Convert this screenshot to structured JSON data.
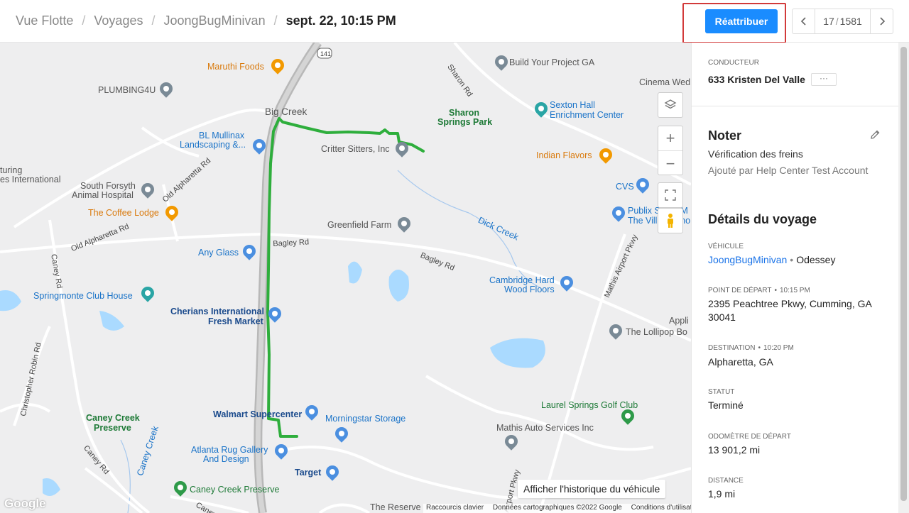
{
  "breadcrumb": {
    "items": [
      "Vue Flotte",
      "Voyages",
      "JoongBugMinivan"
    ],
    "current": "sept. 22, 10:15 PM"
  },
  "toolbar": {
    "reassign_label": "Réattribuer",
    "pager_current": "17",
    "pager_total": "1581",
    "pager_separator": "/"
  },
  "map": {
    "labels": [
      {
        "text": "Maruthi Foods",
        "kind": "orange"
      },
      {
        "text": "Build Your Project GA",
        "kind": "plain"
      },
      {
        "text": "Sharon Rd",
        "kind": "road"
      },
      {
        "text": "PLUMBING4U",
        "kind": "plain"
      },
      {
        "text": "Cinema Wed",
        "kind": "plain"
      },
      {
        "text": "Big Creek",
        "kind": "plain"
      },
      {
        "text": "Sexton Hall",
        "kind": "blue"
      },
      {
        "text": "Enrichment Center",
        "kind": "blue"
      },
      {
        "text": "Sharon",
        "kind": "green"
      },
      {
        "text": "Springs Park",
        "kind": "green"
      },
      {
        "text": "BL Mullinax",
        "kind": "blue"
      },
      {
        "text": "Landscaping &...",
        "kind": "blue"
      },
      {
        "text": "Critter Sitters, Inc",
        "kind": "plain"
      },
      {
        "text": "Indian Flavors",
        "kind": "orange"
      },
      {
        "text": "turing",
        "kind": "plain"
      },
      {
        "text": "es International",
        "kind": "plain"
      },
      {
        "text": "Old Alpharetta Rd",
        "kind": "road"
      },
      {
        "text": "South Forsyth",
        "kind": "plain"
      },
      {
        "text": "Animal Hospital",
        "kind": "plain"
      },
      {
        "text": "CVS",
        "kind": "blue"
      },
      {
        "text": "The Coffee Lodge",
        "kind": "orange"
      },
      {
        "text": "Publix Super M",
        "kind": "blue"
      },
      {
        "text": "The Village Sho",
        "kind": "blue"
      },
      {
        "text": "Old Alpharetta Rd",
        "kind": "road"
      },
      {
        "text": "Greenfield Farm",
        "kind": "plain"
      },
      {
        "text": "Dick Creek",
        "kind": "blue"
      },
      {
        "text": "Any Glass",
        "kind": "blue"
      },
      {
        "text": "Bagley Rd",
        "kind": "road"
      },
      {
        "text": "Bagley Rd",
        "kind": "road"
      },
      {
        "text": "Mathis Airport Pkwy",
        "kind": "road"
      },
      {
        "text": "Caney Rd",
        "kind": "road"
      },
      {
        "text": "Cambridge Hard",
        "kind": "blue"
      },
      {
        "text": "Wood Floors",
        "kind": "blue"
      },
      {
        "text": "Springmonte Club House",
        "kind": "blue"
      },
      {
        "text": "Cherians International",
        "kind": "dark"
      },
      {
        "text": "Fresh Market",
        "kind": "dark"
      },
      {
        "text": "Appli",
        "kind": "plain"
      },
      {
        "text": "The Lollipop Bo",
        "kind": "plain"
      },
      {
        "text": "Christopher Robin Rd",
        "kind": "road"
      },
      {
        "text": "Laurel Springs Golf Club",
        "kind": "green"
      },
      {
        "text": "Walmart Supercenter",
        "kind": "dark"
      },
      {
        "text": "Morningstar Storage",
        "kind": "blue"
      },
      {
        "text": "Caney Creek",
        "kind": "green"
      },
      {
        "text": "Preserve",
        "kind": "green"
      },
      {
        "text": "Mathis Auto Services Inc",
        "kind": "plain"
      },
      {
        "text": "Atlanta Rug Gallery",
        "kind": "blue"
      },
      {
        "text": "And Design",
        "kind": "blue"
      },
      {
        "text": "Caney Rd",
        "kind": "road"
      },
      {
        "text": "Caney Creek",
        "kind": "blue"
      },
      {
        "text": "Target",
        "kind": "dark"
      },
      {
        "text": "Airport Pkwy",
        "kind": "road"
      },
      {
        "text": "Caney Creek Preserve",
        "kind": "green"
      },
      {
        "text": "The Reserve",
        "kind": "plain"
      },
      {
        "text": "Caney Pl",
        "kind": "road"
      },
      {
        "text": "141",
        "kind": "shield"
      }
    ],
    "history_button": "Afficher l'historique du véhicule",
    "attribution": {
      "shortcuts": "Raccourcis clavier",
      "data": "Données cartographiques ©2022 Google",
      "terms": "Conditions d'utilisation"
    },
    "google_logo": "Google",
    "route_color": "#2eae3c"
  },
  "panel": {
    "driver_label": "CONDUCTEUR",
    "driver_name": "633 Kristen Del Valle",
    "more_label": "···",
    "note_title": "Noter",
    "note_text": "Vérification des freins",
    "note_added_by": "Ajouté par Help Center Test Account",
    "details_title": "Détails du voyage",
    "vehicle_label": "VÉHICULE",
    "vehicle_name": "JoongBugMinivan",
    "vehicle_model": "Odessey",
    "start_label": "POINT DE DÉPART",
    "start_time": "10:15 PM",
    "start_address": "2395 Peachtree Pkwy, Cumming, GA 30041",
    "dest_label": "DESTINATION",
    "dest_time": "10:20 PM",
    "dest_address": "Alpharetta, GA",
    "status_label": "STATUT",
    "status_value": "Terminé",
    "odometer_label": "ODOMÈTRE DE DÉPART",
    "odometer_value": "13 901,2 mi",
    "distance_label": "DISTANCE",
    "distance_value": "1,9 mi",
    "dot_separator": "•"
  },
  "colors": {
    "accent": "#1a8cff",
    "highlight_border": "#d23a3a",
    "link": "#1a73e8"
  }
}
